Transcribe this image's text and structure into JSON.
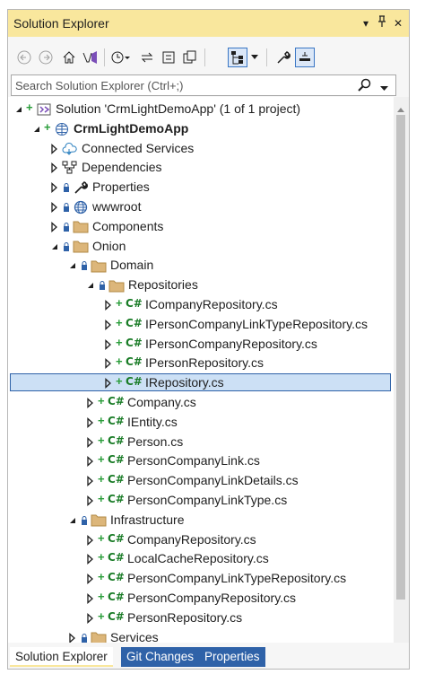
{
  "window": {
    "title": "Solution Explorer",
    "dropdown_glyph": "▾",
    "pin_glyph": "⊥",
    "close_glyph": "✕"
  },
  "toolbar": {
    "icons": [
      "back-arrow-icon",
      "forward-arrow-icon",
      "home-icon",
      "vs-switch-view-icon",
      "history-icon",
      "sync-icon",
      "collapse-all-icon",
      "show-all-files-icon",
      "tree-view-icon",
      "properties-wrench-icon",
      "preview-icon"
    ]
  },
  "search": {
    "placeholder": "Search Solution Explorer (Ctrl+;)"
  },
  "tree": {
    "rows": [
      {
        "label": "Solution 'CrmLightDemoApp' (1 of 1 project)",
        "icon": "solution-icon"
      },
      {
        "label": "CrmLightDemoApp",
        "icon": "web-project-icon"
      },
      {
        "label": "Connected Services",
        "icon": "cloud-icon"
      },
      {
        "label": "Dependencies",
        "icon": "dependencies-icon"
      },
      {
        "label": "Properties",
        "icon": "properties-wrench-icon"
      },
      {
        "label": "wwwroot",
        "icon": "globe-icon"
      },
      {
        "label": "Components",
        "icon": "folder-icon"
      },
      {
        "label": "Onion",
        "icon": "folder-icon"
      },
      {
        "label": "Domain",
        "icon": "folder-icon"
      },
      {
        "label": "Repositories",
        "icon": "folder-icon"
      },
      {
        "label": "ICompanyRepository.cs",
        "icon": "csharp-icon"
      },
      {
        "label": "IPersonCompanyLinkTypeRepository.cs",
        "icon": "csharp-icon"
      },
      {
        "label": "IPersonCompanyRepository.cs",
        "icon": "csharp-icon"
      },
      {
        "label": "IPersonRepository.cs",
        "icon": "csharp-icon"
      },
      {
        "label": "IRepository.cs",
        "icon": "csharp-icon"
      },
      {
        "label": "Company.cs",
        "icon": "csharp-icon"
      },
      {
        "label": "IEntity.cs",
        "icon": "csharp-icon"
      },
      {
        "label": "Person.cs",
        "icon": "csharp-icon"
      },
      {
        "label": "PersonCompanyLink.cs",
        "icon": "csharp-icon"
      },
      {
        "label": "PersonCompanyLinkDetails.cs",
        "icon": "csharp-icon"
      },
      {
        "label": "PersonCompanyLinkType.cs",
        "icon": "csharp-icon"
      },
      {
        "label": "Infrastructure",
        "icon": "folder-icon"
      },
      {
        "label": "CompanyRepository.cs",
        "icon": "csharp-icon"
      },
      {
        "label": "LocalCacheRepository.cs",
        "icon": "csharp-icon"
      },
      {
        "label": "PersonCompanyLinkTypeRepository.cs",
        "icon": "csharp-icon"
      },
      {
        "label": "PersonCompanyRepository.cs",
        "icon": "csharp-icon"
      },
      {
        "label": "PersonRepository.cs",
        "icon": "csharp-icon"
      },
      {
        "label": "Services",
        "icon": "folder-icon"
      }
    ],
    "csharp_badge": "C#"
  },
  "tabs": [
    {
      "label": "Solution Explorer",
      "active": true
    },
    {
      "label": "Git Changes",
      "active": false
    },
    {
      "label": "Properties",
      "active": false
    }
  ],
  "colors": {
    "title_bar": "#f9e79d",
    "selection": "#cce0f5",
    "added_plus": "#2a9d3a",
    "csharp": "#1a7c27",
    "tab_inactive": "#2f62a8"
  }
}
